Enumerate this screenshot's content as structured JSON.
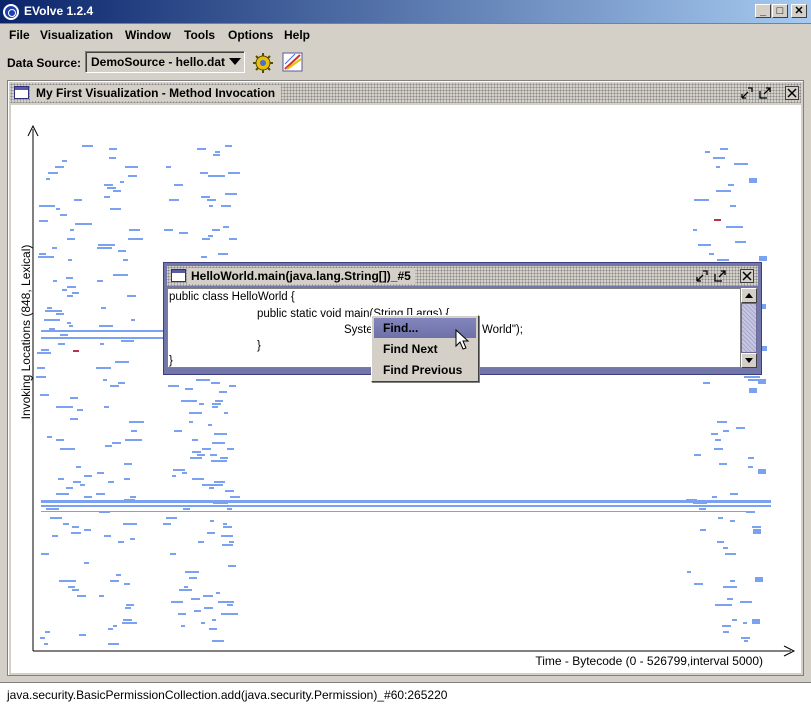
{
  "window": {
    "title": "EVolve 1.2.4",
    "minimize_label": "_",
    "maximize_label": "□",
    "close_label": "✕"
  },
  "menubar": {
    "items": [
      {
        "label": "File"
      },
      {
        "label": "Visualization"
      },
      {
        "label": "Window"
      },
      {
        "label": "Tools"
      },
      {
        "label": "Options"
      },
      {
        "label": "Help"
      }
    ]
  },
  "toolbar": {
    "data_source_label": "Data Source:",
    "data_source_value": "DemoSource - hello.dat",
    "buttons": [
      {
        "icon": "gear-run-icon"
      },
      {
        "icon": "chart-edit-icon"
      }
    ]
  },
  "visualization_frame": {
    "title": "My First Visualization - Method Invocation",
    "y_axis_label": "Invoking Locations (848, Lexical)",
    "x_axis_label": "Time - Bytecode (0 - 526799,interval 5000)",
    "point_color": "#7ba1f1",
    "highlight_color": "#c0304c"
  },
  "code_frame": {
    "title": "HelloWorld.main(java.lang.String[])_#5",
    "lines": [
      "public class HelloWorld {",
      "public static void main(String [] args) {",
      "Syste",
      "World\");",
      "}",
      "}"
    ]
  },
  "context_menu": {
    "items": [
      {
        "label": "Find...",
        "active": true
      },
      {
        "label": "Find Next",
        "active": false
      },
      {
        "label": "Find Previous",
        "active": false
      }
    ]
  },
  "statusbar": {
    "text": "java.security.BasicPermissionCollection.add(java.security.Permission)_#60:265220"
  }
}
